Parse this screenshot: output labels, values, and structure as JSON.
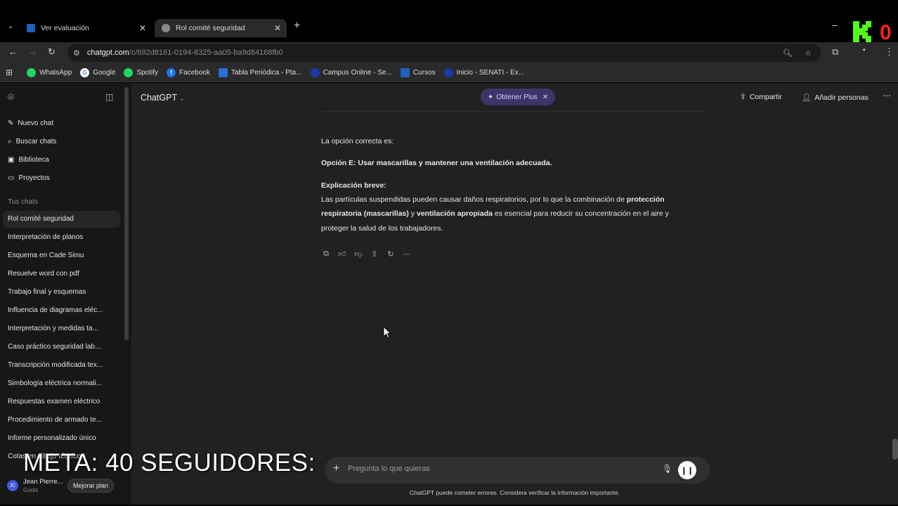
{
  "browser": {
    "tabs": [
      {
        "title": "Ver evaluación",
        "active": false
      },
      {
        "title": "Rol comité seguridad",
        "active": true
      }
    ],
    "url_host": "chatgpt.com",
    "url_path": "/c/692d8161-0194-8325-aa05-ba9d84168fb0",
    "bookmarks": [
      "WhatsApp",
      "Google",
      "Spotify",
      "Facebook",
      "Tabla Periódica - Pta...",
      "Campus Online - Se...",
      "Cursos",
      "Inicio - SENATI - Ex..."
    ]
  },
  "sidebar": {
    "nav": [
      "Nuevo chat",
      "Buscar chats",
      "Biblioteca",
      "Proyectos"
    ],
    "section_label": "Tus chats",
    "chats": [
      "Rol comité seguridad",
      "Interpretación de planos",
      "Esquema en Cade Simu",
      "Resuelve word con pdf",
      "Trabajo final y esquemas",
      "Influencia de diagramas eléc...",
      "Interpretación y medidas ta...",
      "Caso práctico seguridad lab...",
      "Transcripción modificada tex...",
      "Simbología eléctrica normali...",
      "Respuestas examen eléctrico",
      "Procedimiento de armado te...",
      "Informe personalizado único",
      "Cotas en dibujo técnico"
    ],
    "user_name": "Jean Pierre...",
    "user_plan": "Gratis",
    "upgrade_label": "Mejorar plan",
    "avatar_initials": "JC"
  },
  "header": {
    "title": "ChatGPT",
    "plus_label": "Obtener Plus",
    "share_label": "Compartir",
    "add_people_label": "Añadir personas"
  },
  "message": {
    "intro": "La opción correcta es:",
    "answer": "Opción E: Usar mascarillas y mantener una ventilación adecuada.",
    "explain_title": "Explicación breve:",
    "line1_a": "Las partículas suspendidas pueden causar daños respiratorios, por lo que la combinación de ",
    "line1_b": "protección",
    "line2_a": "respiratoria (mascarillas)",
    "line2_b": " y ",
    "line2_c": "ventilación apropiada",
    "line2_d": " es esencial para reducir su concentración en el aire y",
    "line3": "proteger la salud de los trabajadores."
  },
  "composer": {
    "placeholder": "Pregunta lo que quieras",
    "footnote": "ChatGPT puede cometer errores. Considera verificar la información importante."
  },
  "overlay": {
    "text": "META: 40 SEGUIDORES:",
    "counter": "0"
  }
}
